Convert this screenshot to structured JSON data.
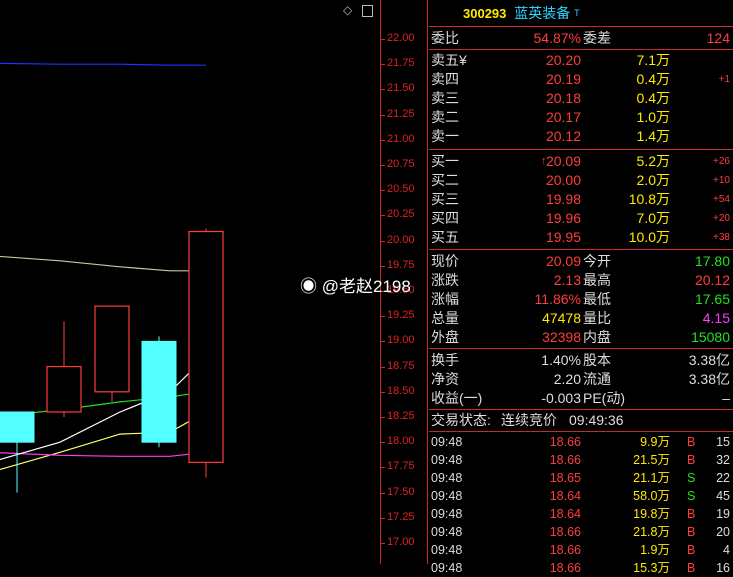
{
  "toolbar": {
    "diamond_icon": "diamond-icon",
    "panel_icon": "panel-toggle-icon"
  },
  "price_axis": {
    "ticks": [
      "22.00",
      "21.75",
      "21.50",
      "21.25",
      "21.00",
      "20.75",
      "20.50",
      "20.25",
      "20.00",
      "19.75",
      "19.50",
      "19.25",
      "19.00",
      "18.75",
      "18.50",
      "18.25",
      "18.00",
      "17.75",
      "17.50",
      "17.25",
      "17.00"
    ]
  },
  "chart_data": {
    "type": "candlestick",
    "ylim": [
      17.0,
      22.0
    ],
    "candles": [
      {
        "open": 18.3,
        "close": 18.0,
        "high": 18.3,
        "low": 17.5
      },
      {
        "open": 18.3,
        "close": 18.75,
        "high": 19.2,
        "low": 18.25
      },
      {
        "open": 18.5,
        "close": 19.35,
        "high": 19.35,
        "low": 18.4
      },
      {
        "open": 19.0,
        "close": 18.0,
        "high": 19.05,
        "low": 17.95
      },
      {
        "open": 17.8,
        "close": 20.09,
        "high": 20.12,
        "low": 17.65
      }
    ],
    "lines": [
      {
        "color": "#2030ff",
        "values": [
          21.76,
          21.75,
          21.75,
          21.74,
          21.74
        ]
      },
      {
        "color": "#cfc2a8",
        "values": [
          19.85,
          19.8,
          19.74,
          19.7,
          19.7
        ]
      },
      {
        "color": "#22e022",
        "values": [
          18.25,
          18.32,
          18.4,
          18.45,
          18.5
        ]
      },
      {
        "color": "#ffff66",
        "values": [
          17.7,
          17.9,
          18.08,
          18.1,
          18.3
        ]
      },
      {
        "color": "#ff3dff",
        "values": [
          17.9,
          17.87,
          17.86,
          17.86,
          17.9
        ]
      },
      {
        "color": "#ffffff",
        "values": [
          17.8,
          18.0,
          18.3,
          18.5,
          18.85
        ]
      }
    ]
  },
  "stock": {
    "code": "300293",
    "name": "蓝英装备",
    "sup": "T"
  },
  "weibi": {
    "label": "委比",
    "value": "54.87%",
    "diff_label": "委差",
    "diff": "124"
  },
  "sell": [
    {
      "label": "卖五",
      "mark": "¥",
      "price": "20.20",
      "vol": "7.1万",
      "chg": ""
    },
    {
      "label": "卖四",
      "mark": "",
      "price": "20.19",
      "vol": "0.4万",
      "chg": "+1"
    },
    {
      "label": "卖三",
      "mark": "",
      "price": "20.18",
      "vol": "0.4万",
      "chg": ""
    },
    {
      "label": "卖二",
      "mark": "",
      "price": "20.17",
      "vol": "1.0万",
      "chg": ""
    },
    {
      "label": "卖一",
      "mark": "",
      "price": "20.12",
      "vol": "1.4万",
      "chg": ""
    }
  ],
  "buy": [
    {
      "label": "买一",
      "mark": "↑",
      "price": "20.09",
      "vol": "5.2万",
      "chg": "+26"
    },
    {
      "label": "买二",
      "mark": "",
      "price": "20.00",
      "vol": "2.0万",
      "chg": "+10"
    },
    {
      "label": "买三",
      "mark": "",
      "price": "19.98",
      "vol": "10.8万",
      "chg": "+54"
    },
    {
      "label": "买四",
      "mark": "",
      "price": "19.96",
      "vol": "7.0万",
      "chg": "+20"
    },
    {
      "label": "买五",
      "mark": "",
      "price": "19.95",
      "vol": "10.0万",
      "chg": "+38"
    }
  ],
  "quote": [
    {
      "l1": "现价",
      "v1": "20.09",
      "c1": "red",
      "l2": "今开",
      "v2": "17.80",
      "c2": "grn"
    },
    {
      "l1": "涨跌",
      "v1": "2.13",
      "c1": "red",
      "l2": "最高",
      "v2": "20.12",
      "c2": "red"
    },
    {
      "l1": "涨幅",
      "v1": "11.86%",
      "c1": "red",
      "l2": "最低",
      "v2": "17.65",
      "c2": "grn"
    },
    {
      "l1": "总量",
      "v1": "47478",
      "c1": "yel",
      "l2": "量比",
      "v2": "4.15",
      "c2": "mag"
    },
    {
      "l1": "外盘",
      "v1": "32398",
      "c1": "red",
      "l2": "内盘",
      "v2": "15080",
      "c2": "grn"
    }
  ],
  "fund": [
    {
      "l1": "换手",
      "v1": "1.40%",
      "l2": "股本",
      "v2": "3.38亿"
    },
    {
      "l1": "净资",
      "v1": "2.20",
      "l2": "流通",
      "v2": "3.38亿"
    },
    {
      "l1": "收益(一)",
      "v1": "-0.003",
      "l2": "PE(动)",
      "v2": "–"
    }
  ],
  "trade_status": {
    "label": "交易状态:",
    "state": "连续竞价",
    "time": "09:49:36"
  },
  "trades": [
    {
      "time": "09:48",
      "price": "18.66",
      "vol": "9.9万",
      "side": "B",
      "n": "15"
    },
    {
      "time": "09:48",
      "price": "18.66",
      "vol": "21.5万",
      "side": "B",
      "n": "32"
    },
    {
      "time": "09:48",
      "price": "18.65",
      "vol": "21.1万",
      "side": "S",
      "n": "22"
    },
    {
      "time": "09:48",
      "price": "18.64",
      "vol": "58.0万",
      "side": "S",
      "n": "45"
    },
    {
      "time": "09:48",
      "price": "18.64",
      "vol": "19.8万",
      "side": "B",
      "n": "19"
    },
    {
      "time": "09:48",
      "price": "18.66",
      "vol": "21.8万",
      "side": "B",
      "n": "20"
    },
    {
      "time": "09:48",
      "price": "18.66",
      "vol": "1.9万",
      "side": "B",
      "n": "4"
    },
    {
      "time": "09:48",
      "price": "18.66",
      "vol": "15.3万",
      "side": "B",
      "n": "16"
    }
  ],
  "watermark": "@老赵2198"
}
